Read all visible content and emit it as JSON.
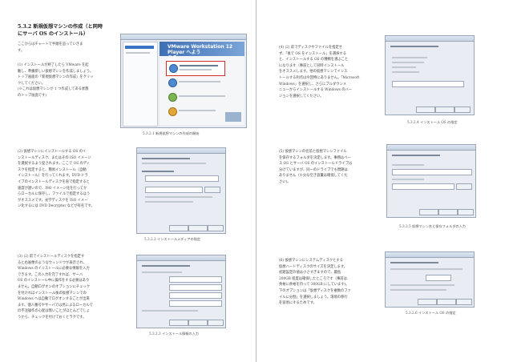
{
  "heading": {
    "line1": "5.3.2 新規仮想マシンの作成（と同時",
    "line2": "にサーバ OS のインストール）"
  },
  "left": {
    "intro": "ここからはチャートで手順を追っていきま\nす。",
    "p1": "(1) インストールが終了したら VMware を起\n動し、準備新しい仮想マシンを作成しましょう。\nトップ画面の「新規仮想マシンの作成」をクリッ\nクしてください。\n(※これは仮想マシンが 1 つ作成してある状態\nのトップ画面です)",
    "cap1": "5.3.2.1 新規仮想マシンの作成の開始",
    "p2": "(2) 仮想マシンにインストールする OS のイ\nンストールディスク、またはその ISO イメージ\nを選択するよう促されます。ここで OS のディ\nスクを指定すると、簡易インストール（自動\nインストール）を行ってくれます。DVD ドラ\nイブのインストールディスクを直で指定すると\n速度が遅いので、ISO イメージ化を行ってか\nらローカルに保存し、ファイルで指定するほう\nがオススメです。光学ディスクを ISO イメー\nジ化するには DVD Decrypter などが有名です。",
    "cap2": "5.3.2.2 インストールメディアの指定",
    "p3": "(3) (2) 前でインストールディスクを指定す\nると右画像のようなウィンドウが表示され、\nWindows のインストールに必要な情報を入力\nできます。この入力を完了すれば、サーバ\nOS のインストール中に操作をする必要はあり\nません。自動ログオンのオプションにチェック\nを付ければインストール後の仮想マシンでの\nWindows へは自動でログオンすることが出来\nます。個人番号やサーバでは見によるローカルで\nの不注操作の心配は無いことがほとんどでしょ\nうから、チェックを付けておくとラクです。",
    "cap3": "5.3.2.3 インストール情報の入力"
  },
  "right": {
    "p4": "(4) (2) 前でディスクやファイルを指定せ\nず、「後で OS をインストール」を選択する\nと、インストールする OS の種類を選ぶこと\nになります（事前として同時インストール\nをオススメします。他の仮想マシンでインス\nトールする利点は今回特にありません。「Microsoft\nWindows」を選択し、さらにプルダウンメ\nニューからインストールする Windows のバー\nジョンを選択してください。",
    "cap4": "5.3.2.4 インストール OS の指定",
    "p5": "(5) 仮想マシンの名前と仮想マシンファイル\nを保存するフォルダを決定します。事務はベー\nス OS とサーバ OS のインストールドライブは\n分けていますが、同一のドライブでも問題は\nありません（十分な空き容量は確保してくだ\nさい)。",
    "cap5": "5.3.2.5 仮想マシン名と保存フォルダの入力",
    "p6": "(6) 仮想マシンにシステムディスクとする\n仮想ハードディスクのサイズを決定します。\n初期設定の値は小さすぎますので、最低\n200GB 程度は確保したところです（事前は\n余裕に余裕を持って 300GB にしています)。\n下のオプションは「仮想ディスクを複数のファ\nイルに分割」を選択しましょう。環境の移行\nを容易にするためです。",
    "cap6": "5.3.2.6 インストール OS の指定"
  },
  "vmware": {
    "title_line1": "VMware Workstation 12 Player へよう",
    "title_line2": "こそ"
  }
}
